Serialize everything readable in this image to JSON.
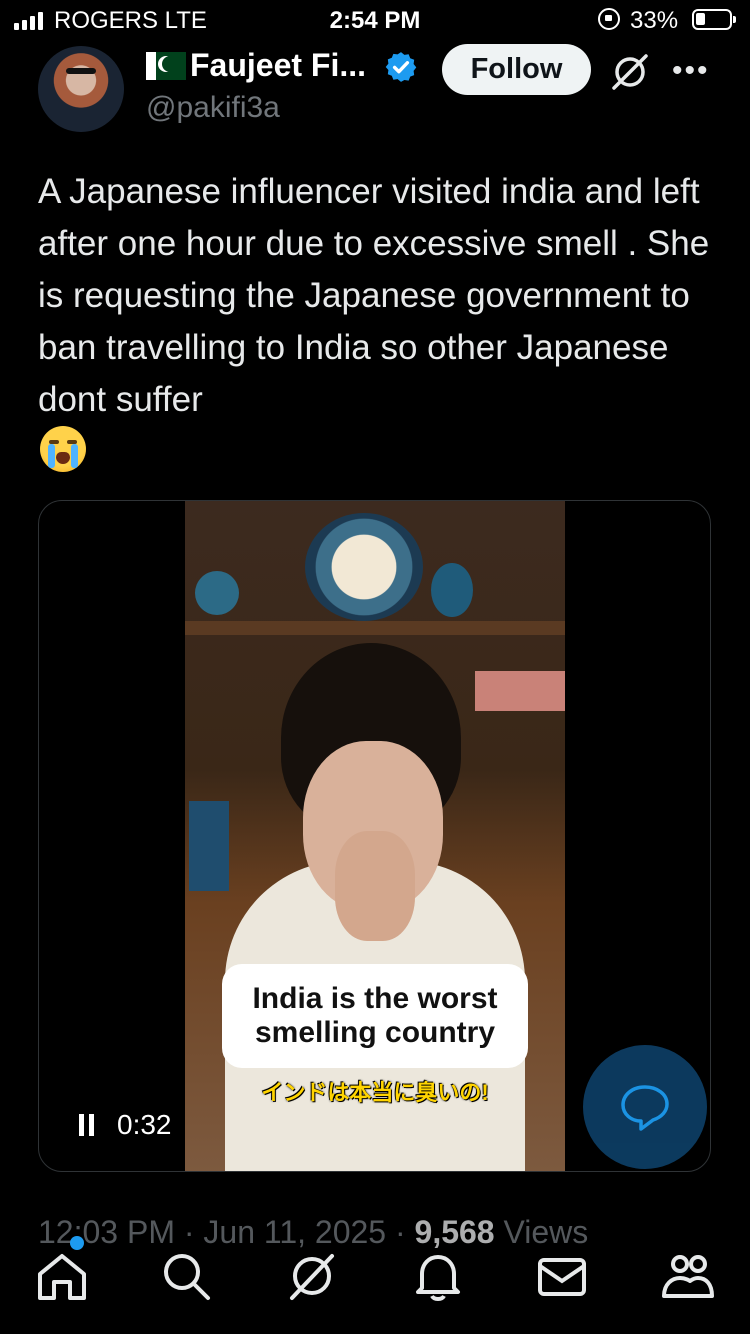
{
  "status_bar": {
    "carrier": "ROGERS  LTE",
    "time": "2:54 PM",
    "battery_percent": "33%",
    "icons": [
      "signal-icon",
      "lock-rotation-icon",
      "battery-icon"
    ]
  },
  "post": {
    "author": {
      "display_name": "Faujeet Fi...",
      "handle": "@pakifi3a",
      "verified": true,
      "flag": "flag-pakistan-icon"
    },
    "follow_label": "Follow",
    "text": "A Japanese influencer visited india and left after one hour due to excessive smell . She is requesting the Japanese government to ban travelling to India so other Japanese dont suffer",
    "emoji": "loudly-crying-face-icon",
    "media": {
      "caption_line1": "India is the worst",
      "caption_line2": "smelling country",
      "jp_caption": "インドは本当に臭いの!",
      "time": "0:32",
      "state": "playing"
    },
    "meta": {
      "time": "12:03 PM",
      "sep1": "·",
      "date": "Jun 11, 2025",
      "sep2": "·",
      "views_count": "9,568",
      "views_label": "Views"
    }
  },
  "nav": {
    "items": [
      "home-icon",
      "search-icon",
      "grok-icon",
      "notifications-icon",
      "messages-icon",
      "communities-icon"
    ]
  },
  "colors": {
    "background": "#000000",
    "text": "#e7e9ea",
    "secondary": "#71767b",
    "accent": "#1d9bf0"
  }
}
